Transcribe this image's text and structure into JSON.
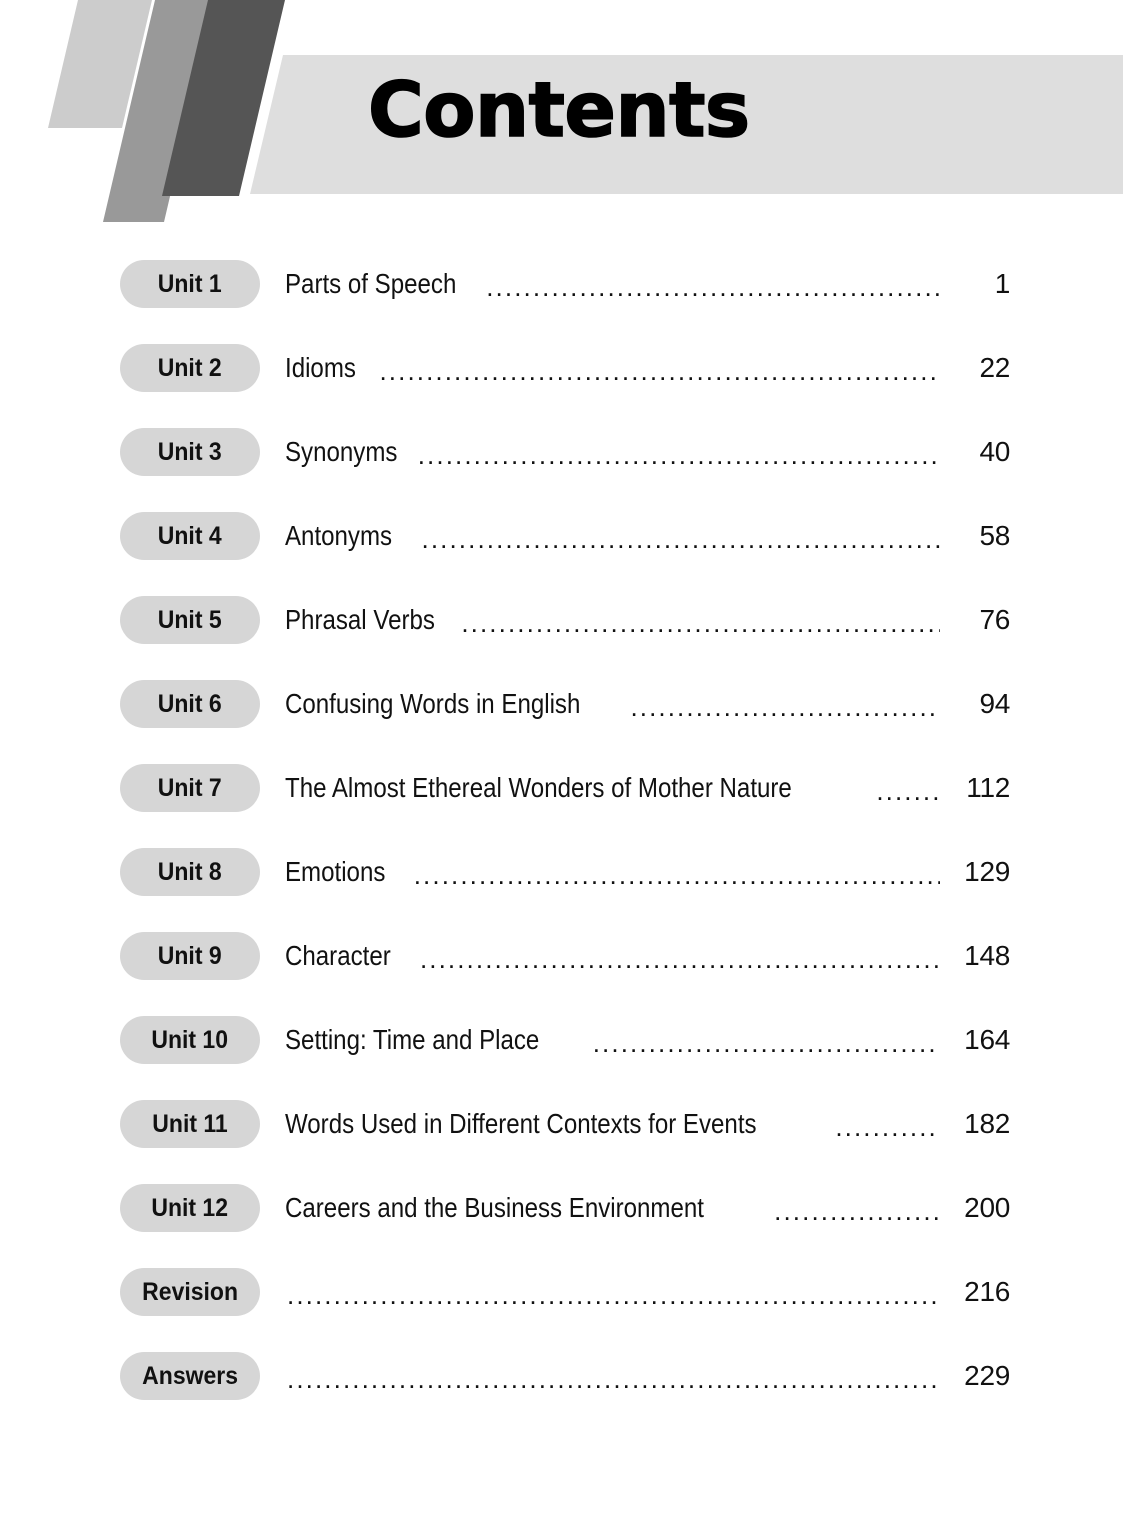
{
  "header": {
    "title": "Contents",
    "banner_color": "#dedede",
    "stripe_colors": [
      "#cccccc",
      "#999999",
      "#555555"
    ]
  },
  "toc": {
    "pill_color": "#d6d6d6",
    "text_color": "#111111",
    "entries": [
      {
        "unit": "Unit 1",
        "title": "Parts of Speech",
        "spaced_leader": false,
        "page": "1"
      },
      {
        "unit": "Unit 2",
        "title": "Idioms",
        "spaced_leader": true,
        "page": "22"
      },
      {
        "unit": "Unit 3",
        "title": "Synonyms",
        "spaced_leader": false,
        "page": "40"
      },
      {
        "unit": "Unit 4",
        "title": "Antonyms",
        "spaced_leader": true,
        "page": "58"
      },
      {
        "unit": "Unit 5",
        "title": "Phrasal Verbs",
        "spaced_leader": false,
        "page": "76"
      },
      {
        "unit": "Unit 6",
        "title": "Confusing Words in English",
        "spaced_leader": false,
        "page": "94"
      },
      {
        "unit": "Unit 7",
        "title": "The Almost Ethereal Wonders of Mother Nature",
        "spaced_leader": false,
        "page": "112"
      },
      {
        "unit": "Unit 8",
        "title": "Emotions",
        "spaced_leader": true,
        "page": "129"
      },
      {
        "unit": "Unit 9",
        "title": "Character",
        "spaced_leader": true,
        "page": "148"
      },
      {
        "unit": "Unit 10",
        "title": "Setting: Time and Place",
        "spaced_leader": true,
        "page": "164"
      },
      {
        "unit": "Unit 11",
        "title": "Words Used in Different Contexts for Events",
        "spaced_leader": false,
        "page": "182"
      },
      {
        "unit": "Unit 12",
        "title": "Careers and the Business Environment",
        "spaced_leader": false,
        "page": "200"
      },
      {
        "unit": "Revision",
        "title": "",
        "spaced_leader": false,
        "page": "216"
      },
      {
        "unit": "Answers",
        "title": "",
        "spaced_leader": false,
        "page": "229"
      }
    ]
  }
}
